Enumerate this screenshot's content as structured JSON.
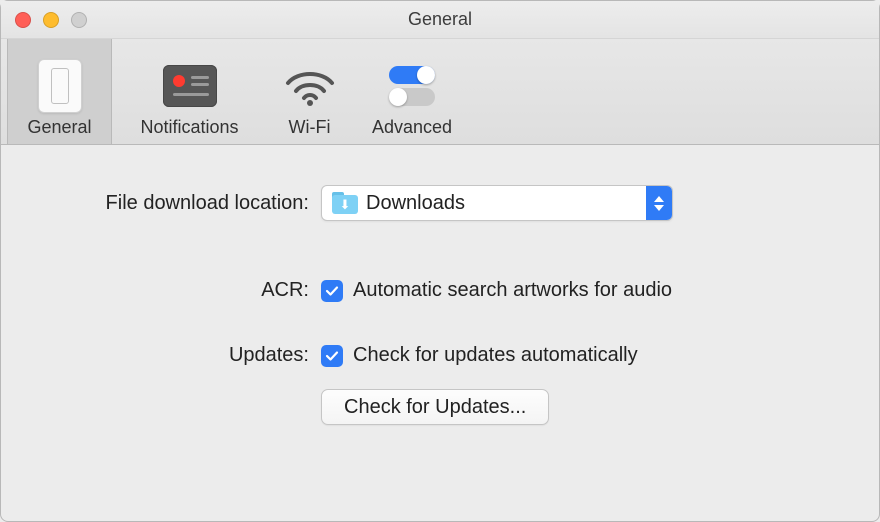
{
  "window": {
    "title": "General"
  },
  "tabs": {
    "general": "General",
    "notifications": "Notifications",
    "wifi": "Wi-Fi",
    "advanced": "Advanced"
  },
  "settings": {
    "download": {
      "label": "File download location:",
      "value": "Downloads"
    },
    "acr": {
      "label": "ACR:",
      "checkbox_label": "Automatic search artworks for audio",
      "checked": true
    },
    "updates": {
      "label": "Updates:",
      "checkbox_label": "Check for updates automatically",
      "checked": true,
      "button": "Check for Updates..."
    }
  }
}
